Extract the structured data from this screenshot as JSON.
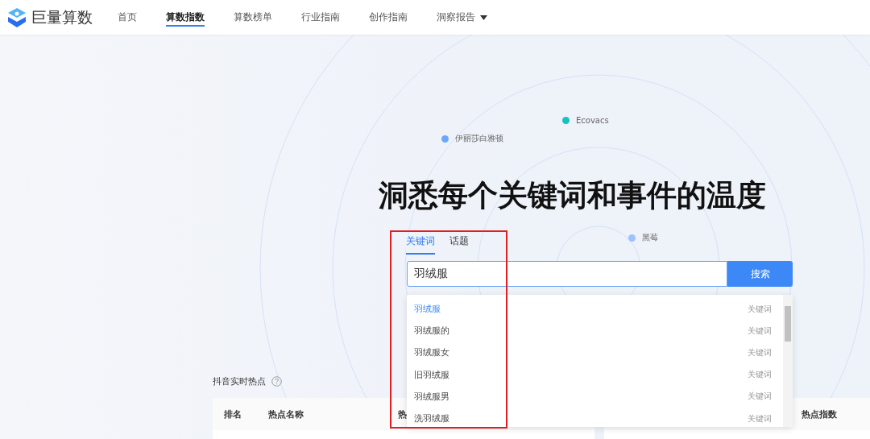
{
  "brand": {
    "name": "巨量算数"
  },
  "nav": [
    {
      "label": "首页",
      "selected": false
    },
    {
      "label": "算数指数",
      "selected": true
    },
    {
      "label": "算数榜单",
      "selected": false
    },
    {
      "label": "行业指南",
      "selected": false
    },
    {
      "label": "创作指南",
      "selected": false
    },
    {
      "label": "洞察报告",
      "selected": false,
      "dropdown": true
    }
  ],
  "hero": {
    "bubbles": [
      {
        "label": "伊丽莎白雅顿",
        "color": "#6aa8ff"
      },
      {
        "label": "Ecovacs",
        "color": "#13c2c2"
      },
      {
        "label": "黑莓",
        "color": "#9cc2ff"
      }
    ],
    "title": "洞悉每个关键词和事件的温度"
  },
  "search": {
    "tabs": [
      {
        "label": "关键词",
        "selected": true
      },
      {
        "label": "话题",
        "selected": false
      }
    ],
    "value": "羽绒服",
    "button": "搜索",
    "suggestions": [
      {
        "text": "羽绒服",
        "type": "关键词",
        "selected": true
      },
      {
        "text": "羽绒服的",
        "type": "关键词",
        "selected": false
      },
      {
        "text": "羽绒服女",
        "type": "关键词",
        "selected": false
      },
      {
        "text": "旧羽绒服",
        "type": "关键词",
        "selected": false
      },
      {
        "text": "羽绒服男",
        "type": "关键词",
        "selected": false
      },
      {
        "text": "洗羽绒服",
        "type": "关键词",
        "selected": false
      }
    ]
  },
  "hot": {
    "title": "抖音实时热点",
    "columns": [
      "排名",
      "热点名称",
      "热"
    ],
    "right_columns": [
      "热点指数"
    ]
  }
}
